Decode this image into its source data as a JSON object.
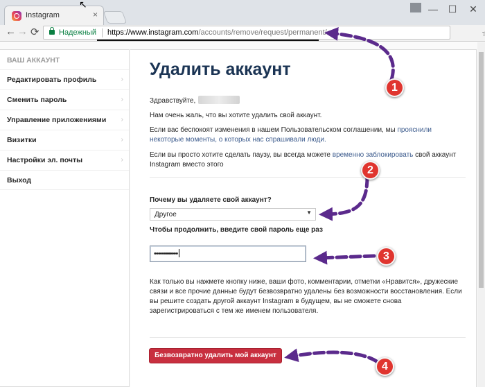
{
  "browser": {
    "tab_title": "Instagram",
    "tab_close": "×",
    "secure_label": "Надежный",
    "url_host": "https://www.instagram.com",
    "url_path": "/accounts/remove/request/permanent/",
    "back": "←",
    "forward": "→",
    "reload": "⟳",
    "star": "☆",
    "menu": "⋮",
    "minimize": "—",
    "maximize": "☐",
    "close": "✕"
  },
  "sidebar": {
    "header": "ВАШ АККАУНТ",
    "items": [
      {
        "label": "Редактировать профиль"
      },
      {
        "label": "Сменить пароль"
      },
      {
        "label": "Управление приложениями"
      },
      {
        "label": "Визитки"
      },
      {
        "label": "Настройки эл. почты"
      },
      {
        "label": "Выход"
      }
    ],
    "chevron": "›"
  },
  "main": {
    "title": "Удалить аккаунт",
    "greeting": "Здравствуйте,",
    "p1": "Нам очень жаль, что вы хотите удалить свой аккаунт.",
    "p2_a": "Если вас беспокоят изменения в нашем Пользовательском соглашении, мы ",
    "p2_link": "прояснили некоторые моменты, о которых нас спрашивали люди.",
    "p3_a": "Если вы просто хотите сделать паузу, вы всегда можете ",
    "p3_link": "временно заблокировать",
    "p3_b": " свой аккаунт Instagram вместо этого",
    "reason_label": "Почему вы удаляете свой аккаунт?",
    "reason_value": "Другое",
    "select_arrow": "▼",
    "password_label": "Чтобы продолжить, введите свой пароль еще раз",
    "password_mask": "••••••••••••",
    "warning": "Как только вы нажмете кнопку ниже, ваши фото, комментарии, отметки «Нравится», дружеские связи и все прочие данные будут безвозвратно удалены без возможности восстановления. Если вы решите создать другой аккаунт Instagram в будущем, вы не сможете снова зарегистрироваться с тем же именем пользователя.",
    "delete_button": "Безвозвратно удалить мой аккаунт"
  },
  "annotations": {
    "badges": [
      "1",
      "2",
      "3",
      "4"
    ],
    "arrow_color": "#5b2a8c",
    "badge_color": "#e0352f"
  }
}
